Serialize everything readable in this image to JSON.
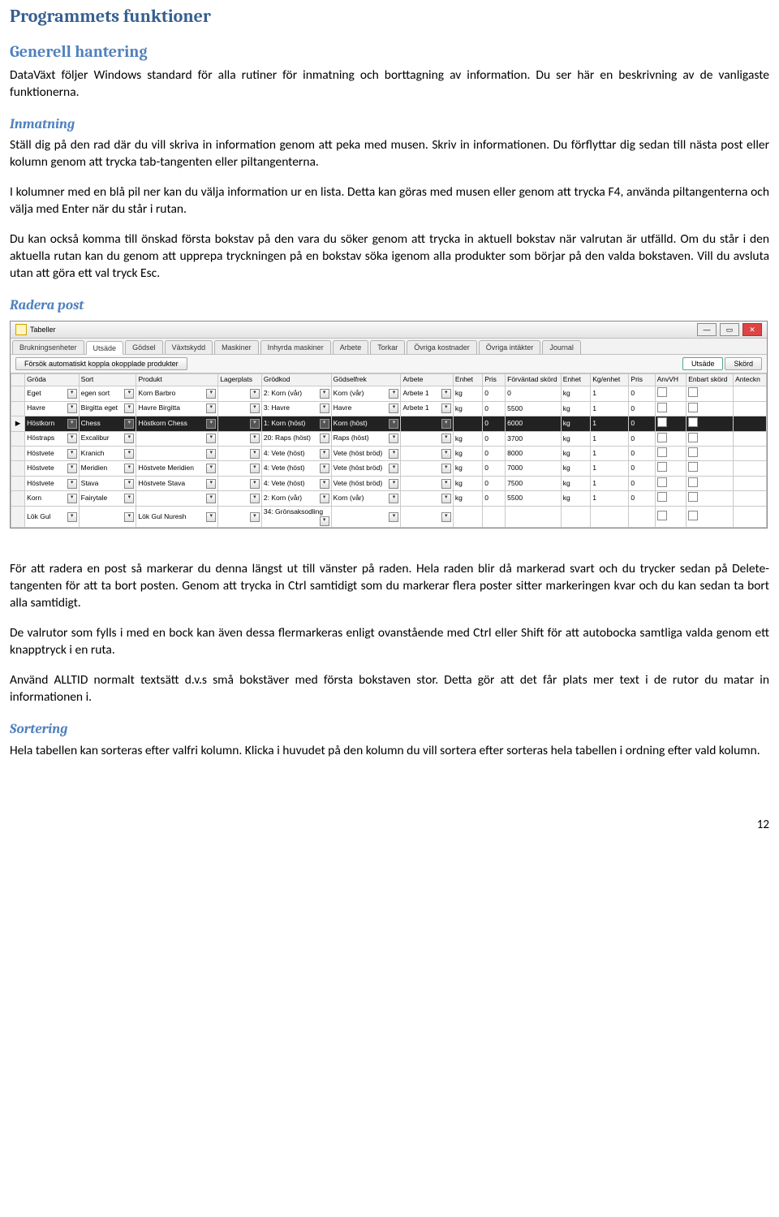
{
  "headings": {
    "h1": "Programmets funktioner",
    "h2_generell": "Generell hantering",
    "h3_inmatning": "Inmatning",
    "h3_radera": "Radera post",
    "h3_sortering": "Sortering"
  },
  "paragraphs": {
    "p1": "DataVäxt följer Windows standard för alla rutiner för inmatning och borttagning av information. Du ser här en beskrivning av de vanligaste funktionerna.",
    "p2": "Ställ dig på den rad där du vill skriva in information genom att peka med musen. Skriv in informationen. Du förflyttar dig sedan till nästa post eller kolumn genom att trycka tab-tangenten eller piltangenterna.",
    "p3": "I kolumner med en blå pil ner kan du välja information ur en lista. Detta kan göras med musen eller genom att trycka F4, använda piltangenterna och välja med Enter när du står i rutan.",
    "p4": "Du kan också komma till önskad första bokstav på den vara du söker genom att trycka in aktuell bokstav när valrutan är utfälld. Om du står i den aktuella rutan kan du genom att upprepa tryckningen på en bokstav söka igenom alla produkter som börjar på den valda bokstaven. Vill du avsluta utan att göra ett val tryck Esc.",
    "p5": "För att radera en post så markerar du denna längst ut till vänster på raden. Hela raden blir då markerad svart och du trycker sedan på Delete-tangenten för att ta bort posten. Genom att trycka in Ctrl samtidigt som du markerar flera poster sitter markeringen kvar och du kan sedan ta bort alla samtidigt.",
    "p6": "De valrutor som fylls i med en bock kan även dessa flermarkeras enligt ovanstående med Ctrl eller Shift för att autobocka samtliga valda genom ett knapptryck i en ruta.",
    "p7": "Använd ALLTID normalt textsätt d.v.s små bokstäver med första bokstaven stor. Detta gör att det får plats mer text i de rutor du matar in informationen i.",
    "p8": "Hela tabellen kan sorteras efter valfri kolumn. Klicka i huvudet på den kolumn du vill sortera efter sorteras hela tabellen i ordning efter vald kolumn."
  },
  "page_number": "12",
  "screenshot": {
    "window_title": "Tabeller",
    "tabs": [
      "Brukningsenheter",
      "Utsäde",
      "Gödsel",
      "Växtskydd",
      "Maskiner",
      "Inhyrda maskiner",
      "Arbete",
      "Torkar",
      "Övriga kostnader",
      "Övriga intäkter",
      "Journal"
    ],
    "active_tab_index": 1,
    "toolbar_button": "Försök automatiskt koppla okopplade produkter",
    "right_tabs": [
      "Utsäde",
      "Skörd"
    ],
    "right_active_index": 0,
    "columns": [
      "",
      "Gröda",
      "Sort",
      "Produkt",
      "Lagerplats",
      "Grödkod",
      "Gödselfrek",
      "Arbete",
      "Enhet",
      "Pris",
      "Förväntad skörd",
      "Enhet",
      "Kg/enhet",
      "Pris",
      "AnvVH",
      "Enbart skörd",
      "Anteckn"
    ],
    "rows": [
      {
        "sel": false,
        "cells": [
          "",
          "Eget",
          "egen sort",
          "Korn Barbro",
          "",
          "2: Korn (vår)",
          "Korn (vår)",
          "Arbete 1",
          "kg",
          "0",
          "0",
          "kg",
          "1",
          "0",
          "",
          ""
        ]
      },
      {
        "sel": false,
        "cells": [
          "",
          "Havre",
          "Birgitta eget",
          "Havre Birgitta",
          "",
          "3: Havre",
          "Havre",
          "Arbete 1",
          "kg",
          "0",
          "5500",
          "kg",
          "1",
          "0",
          "",
          ""
        ]
      },
      {
        "sel": true,
        "cells": [
          "▶",
          "Höstkorn",
          "Chess",
          "Höstkorn Chess",
          "",
          "1: Korn (höst)",
          "Korn (höst)",
          "",
          "",
          "0",
          "6000",
          "kg",
          "1",
          "0",
          "",
          ""
        ]
      },
      {
        "sel": false,
        "cells": [
          "",
          "Höstraps",
          "Excalibur",
          "",
          "",
          "20: Raps (höst)",
          "Raps (höst)",
          "",
          "kg",
          "0",
          "3700",
          "kg",
          "1",
          "0",
          "",
          ""
        ]
      },
      {
        "sel": false,
        "cells": [
          "",
          "Höstvete",
          "Kranich",
          "",
          "",
          "4: Vete (höst)",
          "Vete (höst bröd)",
          "",
          "kg",
          "0",
          "8000",
          "kg",
          "1",
          "0",
          "",
          ""
        ]
      },
      {
        "sel": false,
        "cells": [
          "",
          "Höstvete",
          "Meridien",
          "Höstvete Meridien",
          "",
          "4: Vete (höst)",
          "Vete (höst bröd)",
          "",
          "kg",
          "0",
          "7000",
          "kg",
          "1",
          "0",
          "",
          ""
        ]
      },
      {
        "sel": false,
        "cells": [
          "",
          "Höstvete",
          "Stava",
          "Höstvete Stava",
          "",
          "4: Vete (höst)",
          "Vete (höst bröd)",
          "",
          "kg",
          "0",
          "7500",
          "kg",
          "1",
          "0",
          "",
          ""
        ]
      },
      {
        "sel": false,
        "cells": [
          "",
          "Korn",
          "Fairytale",
          "",
          "",
          "2: Korn (vår)",
          "Korn (vår)",
          "",
          "kg",
          "0",
          "5500",
          "kg",
          "1",
          "0",
          "",
          ""
        ]
      },
      {
        "sel": false,
        "cells": [
          "",
          "Lök Gul",
          "",
          "Lök Gul Nuresh",
          "",
          "34: Grönsaksodling",
          "",
          "",
          "",
          "",
          "",
          "",
          "",
          "",
          "",
          ""
        ]
      }
    ],
    "dropdown_cols": [
      1,
      2,
      3,
      4,
      5,
      6,
      7
    ]
  }
}
